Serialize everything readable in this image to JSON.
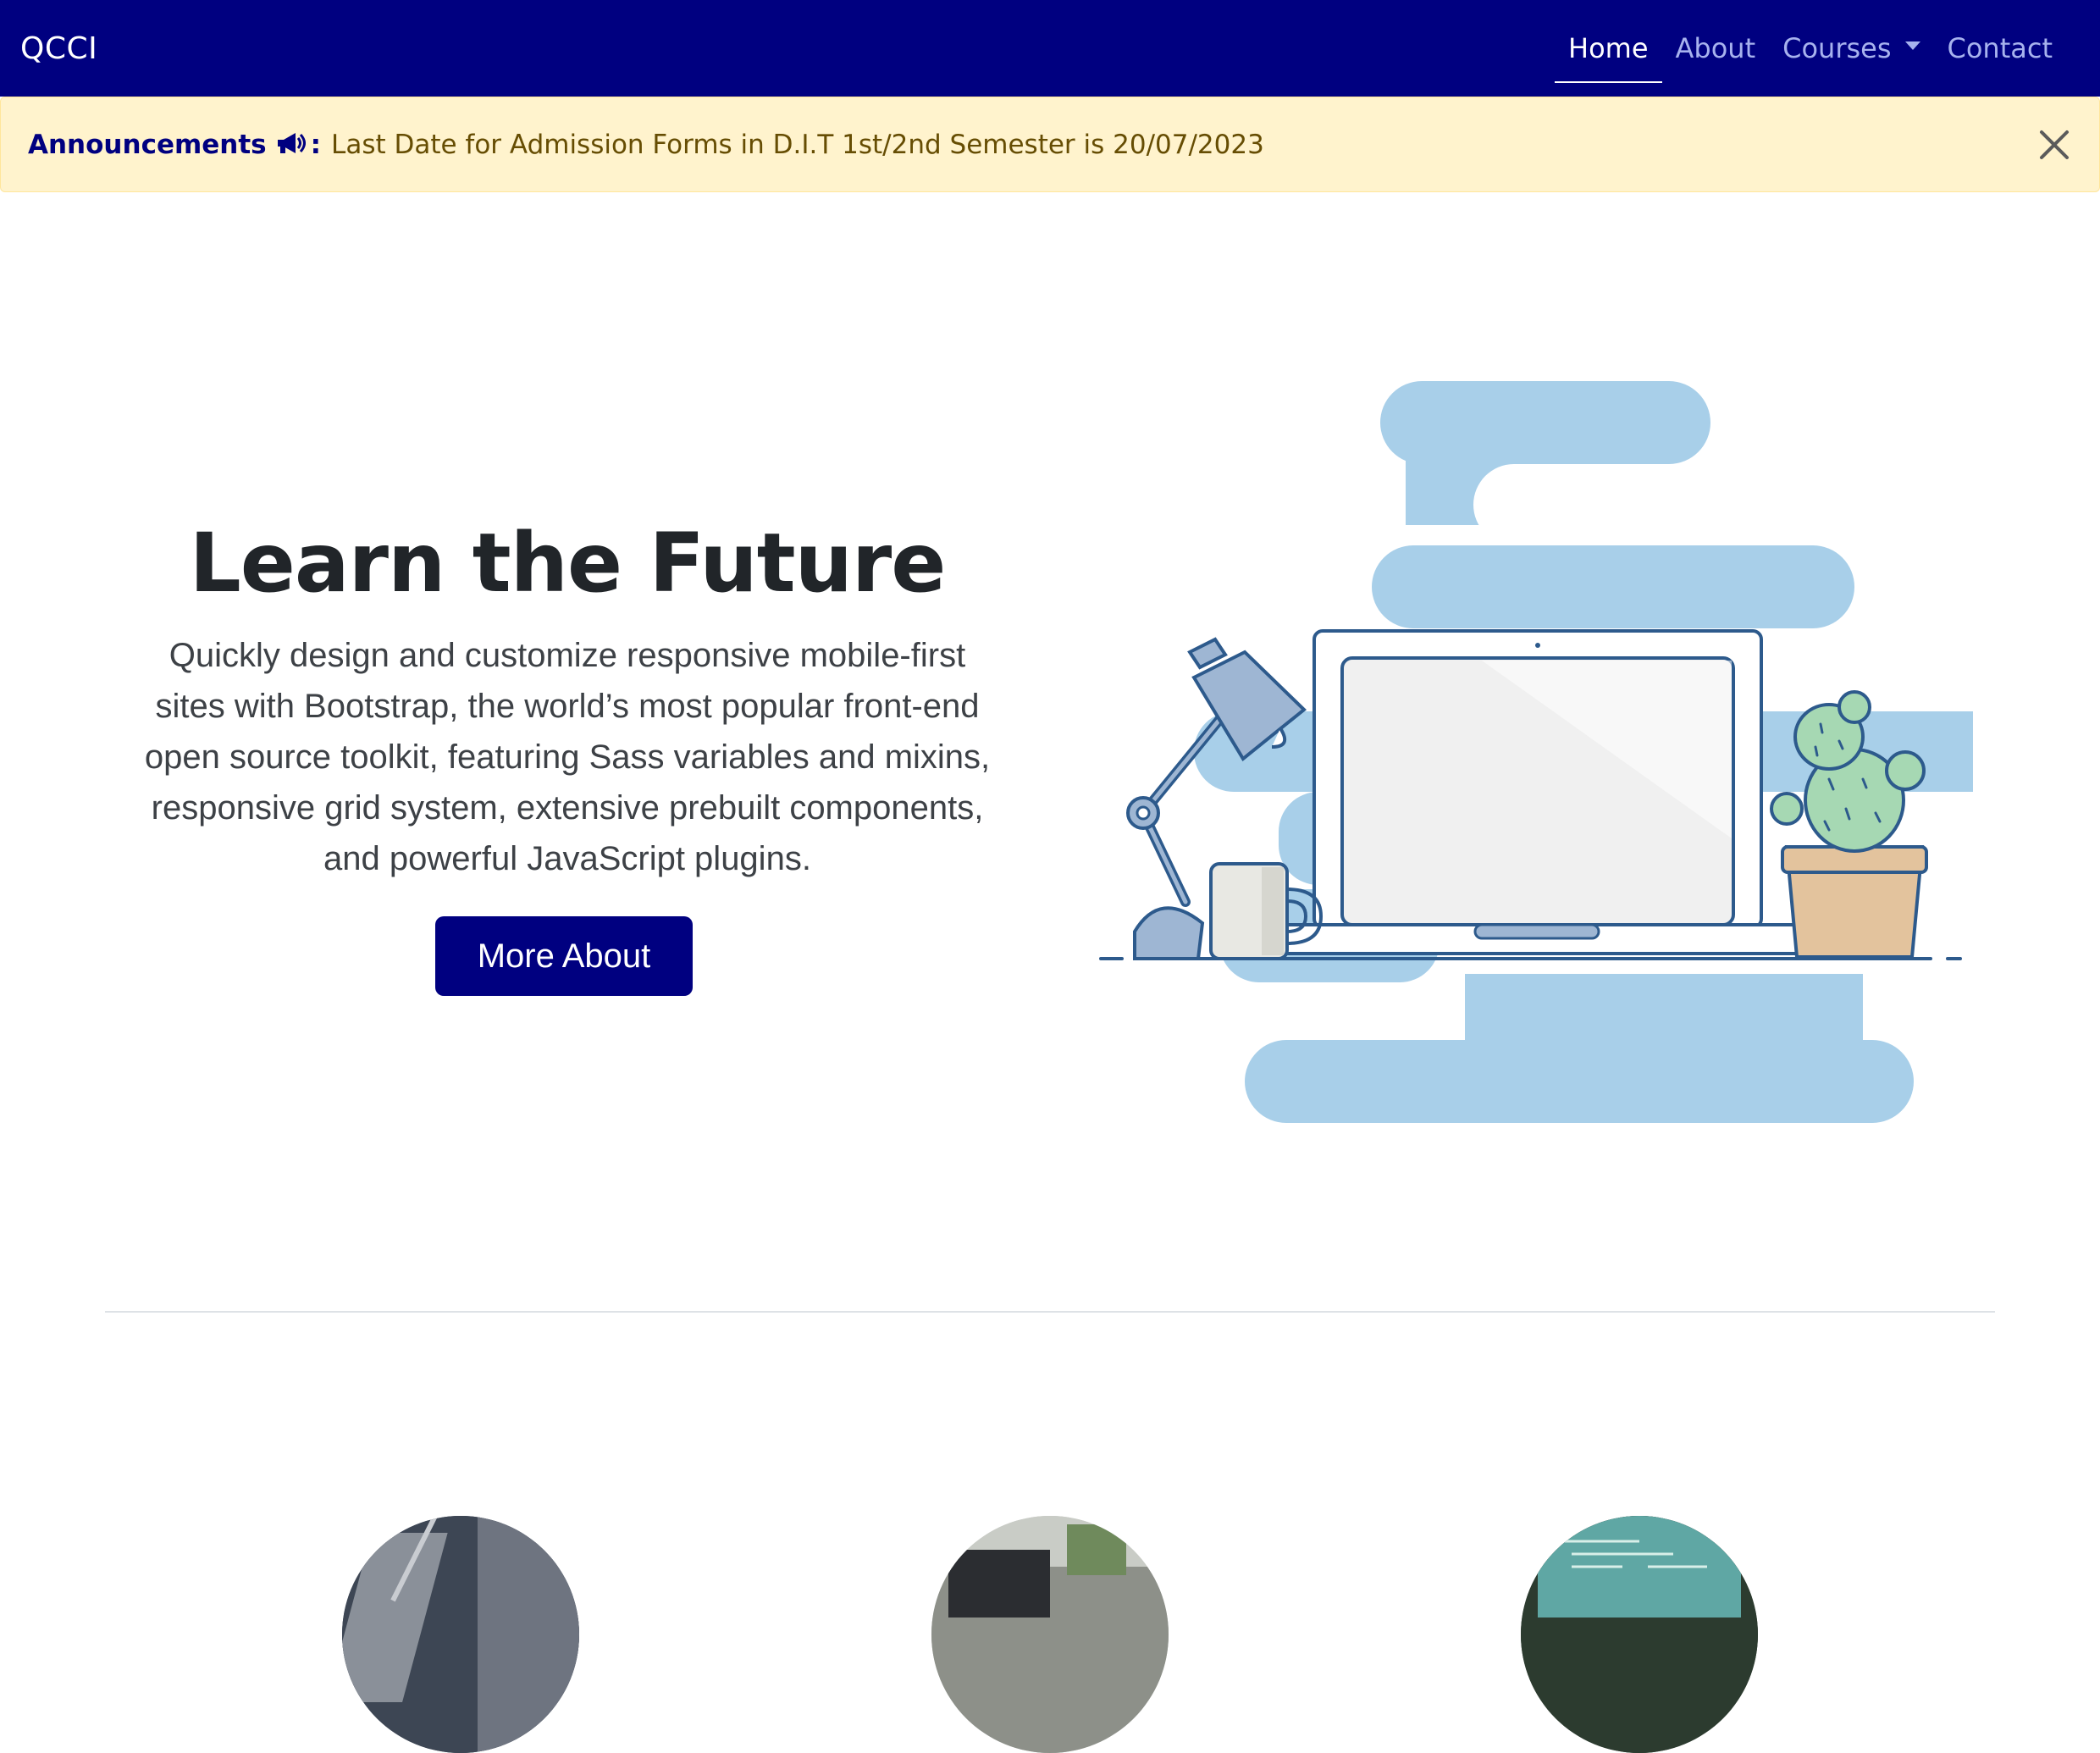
{
  "navbar": {
    "brand": "QCCI",
    "links": [
      {
        "label": "Home",
        "active": true
      },
      {
        "label": "About",
        "active": false
      },
      {
        "label": "Courses",
        "active": false,
        "dropdown": true
      },
      {
        "label": "Contact",
        "active": false
      }
    ],
    "bg_color": "#000080"
  },
  "announcement": {
    "title": "Announcements",
    "icon": "megaphone-icon",
    "separator": ":",
    "text": "Last Date for Admission Forms in D.I.T 1st/2nd Semester is 20/07/2023",
    "close_icon": "close-icon",
    "bg_color": "#fff3cd"
  },
  "hero": {
    "title": "Learn the Future",
    "lead": "Quickly design and customize responsive mobile-first sites with Bootstrap, the world’s most popular front-end open source toolkit, featuring Sass variables and mixins, responsive grid system, extensive prebuilt components, and powerful JavaScript plugins.",
    "button_label": "More About",
    "illustration": "desk-laptop-illustration"
  },
  "features": [
    {
      "image": "laptop-photo"
    },
    {
      "image": "workspace-photo"
    },
    {
      "image": "code-screen-photo"
    }
  ]
}
